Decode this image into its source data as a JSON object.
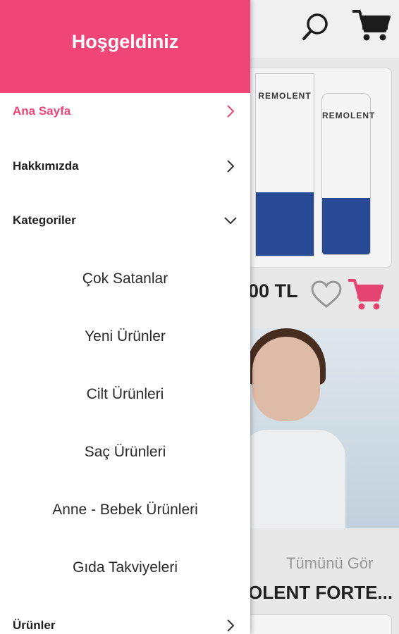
{
  "drawer": {
    "title": "Hoşgeldiniz",
    "accent_color": "#ef4677",
    "items": [
      {
        "label": "Ana Sayfa",
        "icon": "chevron-right-icon",
        "active": true
      },
      {
        "label": "Hakkımızda",
        "icon": "chevron-right-icon",
        "active": false
      },
      {
        "label": "Kategoriler",
        "icon": "chevron-down-icon",
        "active": false,
        "expanded": true,
        "children": [
          "Çok Satanlar",
          "Yeni Ürünler",
          "Cilt Ürünleri",
          "Saç Ürünleri",
          "Anne - Bebek Ürünleri",
          "Gıda Takviyeleri"
        ]
      },
      {
        "label": "Ürünler",
        "icon": "chevron-right-icon",
        "active": false
      }
    ]
  },
  "background": {
    "header_icons": [
      "search-icon",
      "cart-icon"
    ],
    "product": {
      "brand": "REMOLENT",
      "price_partial": "00 TL",
      "icons": [
        "heart-icon",
        "cart-icon"
      ]
    },
    "see_all": "Tümünü Gör",
    "section_title": "OLENT FORTE..."
  }
}
